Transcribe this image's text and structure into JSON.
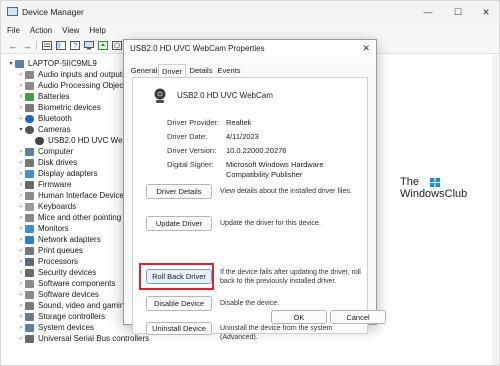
{
  "device_manager": {
    "title": "Device Manager",
    "menu": [
      "File",
      "Action",
      "View",
      "Help"
    ],
    "window_controls": {
      "minimize": "—",
      "maximize": "☐",
      "close": "✕"
    },
    "toolbar": {
      "back": "←",
      "forward": "→"
    },
    "tree": {
      "root": "LAPTOP-5IIC9ML9",
      "items": [
        "Audio inputs and outputs",
        "Audio Processing Objects",
        "Batteries",
        "Biometric devices",
        "Bluetooth",
        "Cameras",
        "USB2.0 HD UVC WebCam",
        "Computer",
        "Disk drives",
        "Display adapters",
        "Firmware",
        "Human Interface Devices",
        "Keyboards",
        "Mice and other pointing",
        "Monitors",
        "Network adapters",
        "Print queues",
        "Processors",
        "Security devices",
        "Software components",
        "Software devices",
        "Sound, video and gaming",
        "Storage controllers",
        "System devices",
        "Universal Serial Bus controllers"
      ]
    }
  },
  "logo": {
    "line1": "The",
    "line2": "WindowsClub"
  },
  "dialog": {
    "title": "USB2.0 HD UVC WebCam Properties",
    "close": "✕",
    "tabs": [
      "General",
      "Driver",
      "Details",
      "Events"
    ],
    "active_tab": "Driver",
    "device_name": "USB2.0 HD UVC WebCam",
    "info": [
      {
        "key": "Driver Provider:",
        "value": "Realtek"
      },
      {
        "key": "Driver Date:",
        "value": "4/11/2023"
      },
      {
        "key": "Driver Version:",
        "value": "10.0.22000.20276"
      },
      {
        "key": "Digital Signer:",
        "value": "Microsoft Windows Hardware Compatibility Publisher"
      }
    ],
    "actions": [
      {
        "label": "Driver Details",
        "desc": "View details about the installed driver files."
      },
      {
        "label": "Update Driver",
        "desc": "Update the driver for this device."
      },
      {
        "label": "Roll Back Driver",
        "desc": "If the device fails after updating the driver, roll back to the previously installed driver."
      },
      {
        "label": "Disable Device",
        "desc": "Disable the device."
      },
      {
        "label": "Uninstall Device",
        "desc": "Uninstall the device from the system (Advanced)."
      }
    ],
    "ok_label": "OK",
    "cancel_label": "Cancel"
  },
  "colors": {
    "highlight": "#d9262a",
    "accent": "#0067c0"
  }
}
